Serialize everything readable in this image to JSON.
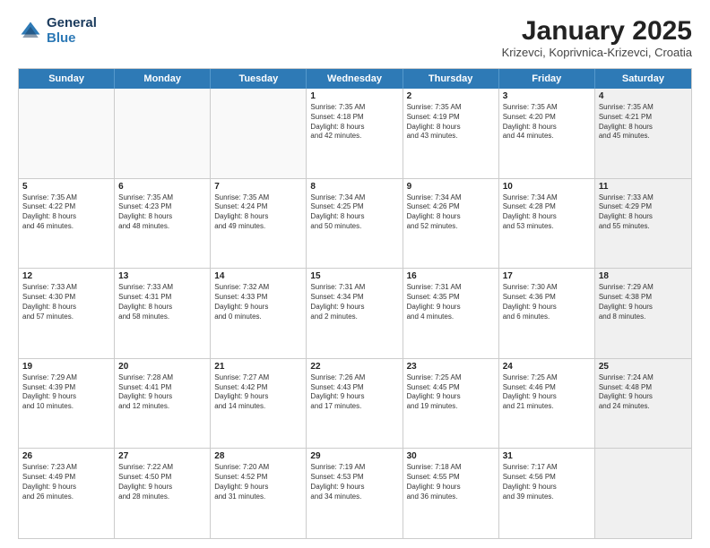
{
  "logo": {
    "line1": "General",
    "line2": "Blue"
  },
  "title": "January 2025",
  "location": "Krizevci, Koprivnica-Krizevci, Croatia",
  "header_days": [
    "Sunday",
    "Monday",
    "Tuesday",
    "Wednesday",
    "Thursday",
    "Friday",
    "Saturday"
  ],
  "rows": [
    [
      {
        "day": "",
        "text": "",
        "empty": true
      },
      {
        "day": "",
        "text": "",
        "empty": true
      },
      {
        "day": "",
        "text": "",
        "empty": true
      },
      {
        "day": "1",
        "text": "Sunrise: 7:35 AM\nSunset: 4:18 PM\nDaylight: 8 hours\nand 42 minutes."
      },
      {
        "day": "2",
        "text": "Sunrise: 7:35 AM\nSunset: 4:19 PM\nDaylight: 8 hours\nand 43 minutes."
      },
      {
        "day": "3",
        "text": "Sunrise: 7:35 AM\nSunset: 4:20 PM\nDaylight: 8 hours\nand 44 minutes."
      },
      {
        "day": "4",
        "text": "Sunrise: 7:35 AM\nSunset: 4:21 PM\nDaylight: 8 hours\nand 45 minutes.",
        "shaded": true
      }
    ],
    [
      {
        "day": "5",
        "text": "Sunrise: 7:35 AM\nSunset: 4:22 PM\nDaylight: 8 hours\nand 46 minutes."
      },
      {
        "day": "6",
        "text": "Sunrise: 7:35 AM\nSunset: 4:23 PM\nDaylight: 8 hours\nand 48 minutes."
      },
      {
        "day": "7",
        "text": "Sunrise: 7:35 AM\nSunset: 4:24 PM\nDaylight: 8 hours\nand 49 minutes."
      },
      {
        "day": "8",
        "text": "Sunrise: 7:34 AM\nSunset: 4:25 PM\nDaylight: 8 hours\nand 50 minutes."
      },
      {
        "day": "9",
        "text": "Sunrise: 7:34 AM\nSunset: 4:26 PM\nDaylight: 8 hours\nand 52 minutes."
      },
      {
        "day": "10",
        "text": "Sunrise: 7:34 AM\nSunset: 4:28 PM\nDaylight: 8 hours\nand 53 minutes."
      },
      {
        "day": "11",
        "text": "Sunrise: 7:33 AM\nSunset: 4:29 PM\nDaylight: 8 hours\nand 55 minutes.",
        "shaded": true
      }
    ],
    [
      {
        "day": "12",
        "text": "Sunrise: 7:33 AM\nSunset: 4:30 PM\nDaylight: 8 hours\nand 57 minutes."
      },
      {
        "day": "13",
        "text": "Sunrise: 7:33 AM\nSunset: 4:31 PM\nDaylight: 8 hours\nand 58 minutes."
      },
      {
        "day": "14",
        "text": "Sunrise: 7:32 AM\nSunset: 4:33 PM\nDaylight: 9 hours\nand 0 minutes."
      },
      {
        "day": "15",
        "text": "Sunrise: 7:31 AM\nSunset: 4:34 PM\nDaylight: 9 hours\nand 2 minutes."
      },
      {
        "day": "16",
        "text": "Sunrise: 7:31 AM\nSunset: 4:35 PM\nDaylight: 9 hours\nand 4 minutes."
      },
      {
        "day": "17",
        "text": "Sunrise: 7:30 AM\nSunset: 4:36 PM\nDaylight: 9 hours\nand 6 minutes."
      },
      {
        "day": "18",
        "text": "Sunrise: 7:29 AM\nSunset: 4:38 PM\nDaylight: 9 hours\nand 8 minutes.",
        "shaded": true
      }
    ],
    [
      {
        "day": "19",
        "text": "Sunrise: 7:29 AM\nSunset: 4:39 PM\nDaylight: 9 hours\nand 10 minutes."
      },
      {
        "day": "20",
        "text": "Sunrise: 7:28 AM\nSunset: 4:41 PM\nDaylight: 9 hours\nand 12 minutes."
      },
      {
        "day": "21",
        "text": "Sunrise: 7:27 AM\nSunset: 4:42 PM\nDaylight: 9 hours\nand 14 minutes."
      },
      {
        "day": "22",
        "text": "Sunrise: 7:26 AM\nSunset: 4:43 PM\nDaylight: 9 hours\nand 17 minutes."
      },
      {
        "day": "23",
        "text": "Sunrise: 7:25 AM\nSunset: 4:45 PM\nDaylight: 9 hours\nand 19 minutes."
      },
      {
        "day": "24",
        "text": "Sunrise: 7:25 AM\nSunset: 4:46 PM\nDaylight: 9 hours\nand 21 minutes."
      },
      {
        "day": "25",
        "text": "Sunrise: 7:24 AM\nSunset: 4:48 PM\nDaylight: 9 hours\nand 24 minutes.",
        "shaded": true
      }
    ],
    [
      {
        "day": "26",
        "text": "Sunrise: 7:23 AM\nSunset: 4:49 PM\nDaylight: 9 hours\nand 26 minutes."
      },
      {
        "day": "27",
        "text": "Sunrise: 7:22 AM\nSunset: 4:50 PM\nDaylight: 9 hours\nand 28 minutes."
      },
      {
        "day": "28",
        "text": "Sunrise: 7:20 AM\nSunset: 4:52 PM\nDaylight: 9 hours\nand 31 minutes."
      },
      {
        "day": "29",
        "text": "Sunrise: 7:19 AM\nSunset: 4:53 PM\nDaylight: 9 hours\nand 34 minutes."
      },
      {
        "day": "30",
        "text": "Sunrise: 7:18 AM\nSunset: 4:55 PM\nDaylight: 9 hours\nand 36 minutes."
      },
      {
        "day": "31",
        "text": "Sunrise: 7:17 AM\nSunset: 4:56 PM\nDaylight: 9 hours\nand 39 minutes."
      },
      {
        "day": "",
        "text": "",
        "empty": true,
        "shaded": true
      }
    ]
  ]
}
